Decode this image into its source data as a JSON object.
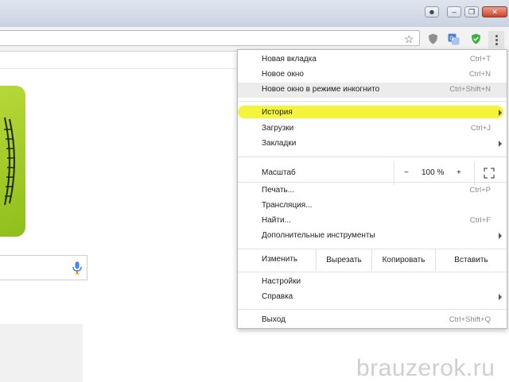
{
  "window": {
    "controls": [
      "user-icon",
      "minimize-icon",
      "restore-icon",
      "close-icon"
    ]
  },
  "toolbar": {
    "icons": [
      "star-icon",
      "shield-icon",
      "translate-icon",
      "adguard-icon",
      "menu-dots-icon"
    ]
  },
  "menu": {
    "new_tab": {
      "label": "Новая вкладка",
      "shortcut": "Ctrl+T"
    },
    "new_window": {
      "label": "Новое окно",
      "shortcut": "Ctrl+N"
    },
    "incognito": {
      "label": "Новое окно в режиме инкогнито",
      "shortcut": "Ctrl+Shift+N"
    },
    "history": {
      "label": "История"
    },
    "downloads": {
      "label": "Загрузки",
      "shortcut": "Ctrl+J"
    },
    "bookmarks": {
      "label": "Закладки"
    },
    "zoom": {
      "label": "Масштаб",
      "minus": "−",
      "value": "100 %",
      "plus": "+"
    },
    "print": {
      "label": "Печать...",
      "shortcut": "Ctrl+P"
    },
    "cast": {
      "label": "Трансляция..."
    },
    "find": {
      "label": "Найти...",
      "shortcut": "Ctrl+F"
    },
    "more_tools": {
      "label": "Дополнительные инструменты"
    },
    "edit": {
      "label": "Изменить",
      "cut": "Вырезать",
      "copy": "Копировать",
      "paste": "Вставить"
    },
    "settings": {
      "label": "Настройки"
    },
    "help": {
      "label": "Справка"
    },
    "exit": {
      "label": "Выход",
      "shortcut": "Ctrl+Shift+Q"
    }
  },
  "highlight_color": "#f4f53a",
  "watermark": "brauzerok.ru"
}
